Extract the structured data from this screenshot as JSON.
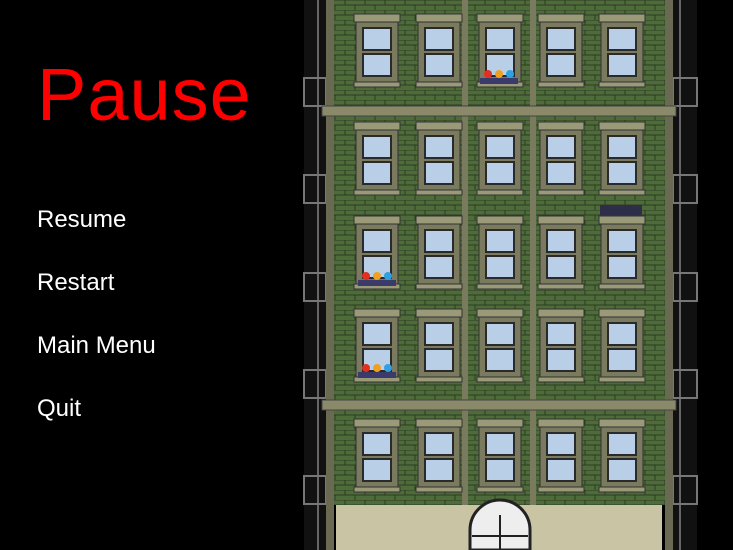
{
  "pause_menu": {
    "title": "Pause",
    "items": [
      {
        "id": "resume",
        "label": "Resume"
      },
      {
        "id": "restart",
        "label": "Restart"
      },
      {
        "id": "main-menu",
        "label": "Main Menu"
      },
      {
        "id": "quit",
        "label": "Quit"
      }
    ]
  },
  "colors": {
    "background": "#000000",
    "title": "#ff0000",
    "menu_text": "#ffffff",
    "brick": "#4e6b3a",
    "brick_line": "#2c3d22",
    "trim": "#8a8a6a",
    "window_glass": "#b9cfe8",
    "ground_floor": "#c8c4a4"
  },
  "scene": {
    "building_floors": 5,
    "windows_per_floor": 5
  }
}
